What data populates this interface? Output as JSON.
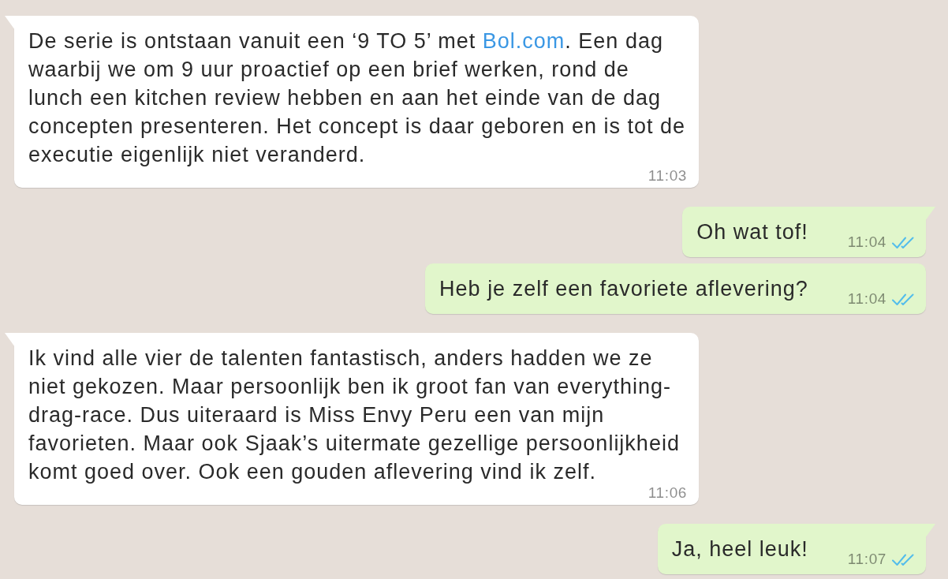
{
  "messages": [
    {
      "kind": "incoming",
      "parts": [
        {
          "kind": "text",
          "text": "De serie is ontstaan vanuit een ‘9 TO 5’ met "
        },
        {
          "kind": "link",
          "text": "Bol.com"
        },
        {
          "kind": "text",
          "text": ". Een dag waarbij we om 9 uur proactief op een brief werken, rond de lunch een kitchen review hebben en aan het einde van de dag concepten presenteren. Het concept is daar geboren en is tot de executie eigenlijk niet veranderd."
        }
      ],
      "time": "11:03"
    },
    {
      "kind": "outgoing",
      "parts": [
        {
          "kind": "text",
          "text": "Oh wat tof!"
        }
      ],
      "time": "11:04",
      "read": true
    },
    {
      "kind": "outgoing",
      "parts": [
        {
          "kind": "text",
          "text": "Heb je zelf een favoriete aflevering?"
        }
      ],
      "time": "11:04",
      "read": true
    },
    {
      "kind": "incoming",
      "parts": [
        {
          "kind": "text",
          "text": "Ik vind alle vier de talenten fantastisch, anders hadden we ze niet gekozen. Maar persoonlijk ben ik groot fan van everything-drag-race. Dus uiteraard is Miss Envy Peru een van mijn favorieten. Maar ook Sjaak’s uitermate gezellige persoonlijkheid komt goed over. Ook een gouden aflevering vind ik zelf."
        }
      ],
      "time": "11:06"
    },
    {
      "kind": "outgoing",
      "parts": [
        {
          "kind": "text",
          "text": "Ja, heel leuk!"
        }
      ],
      "time": "11:07",
      "read": true
    }
  ]
}
